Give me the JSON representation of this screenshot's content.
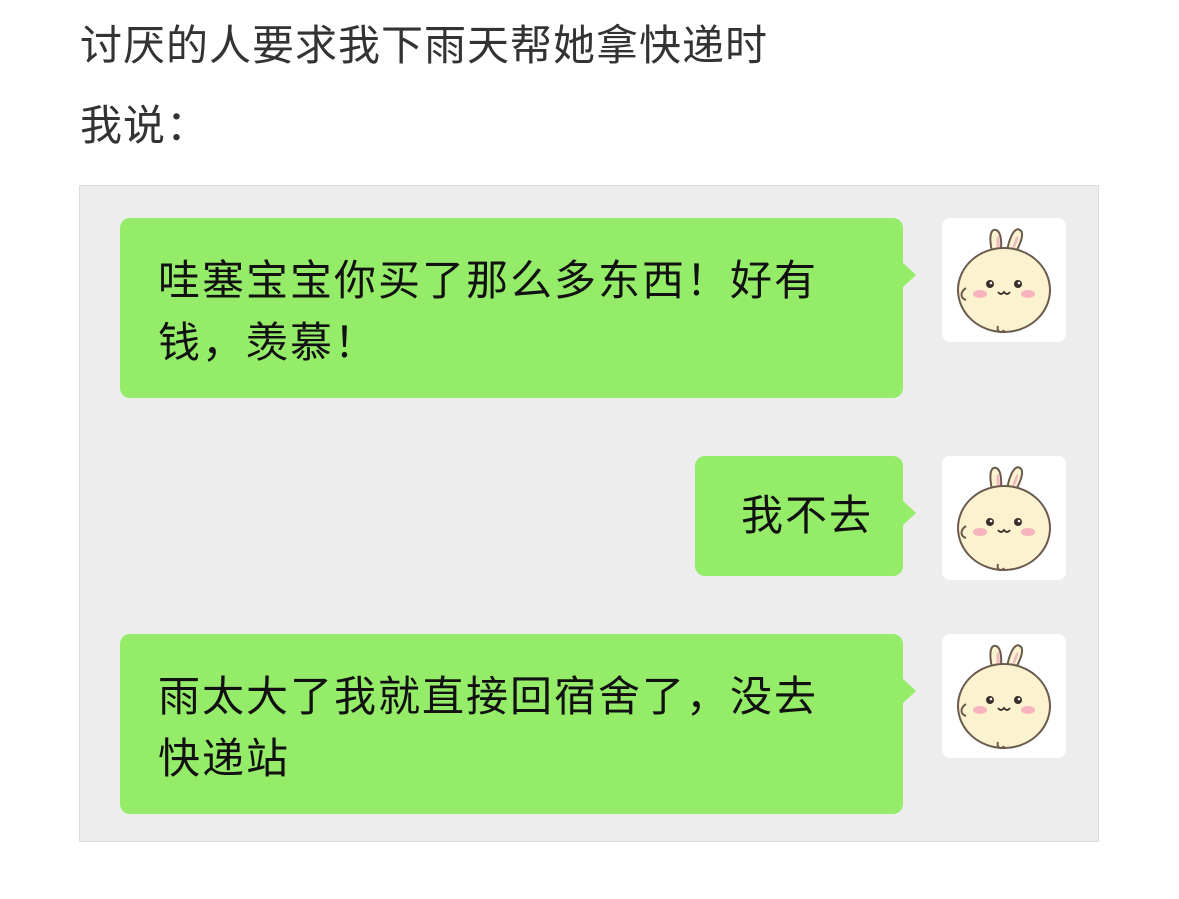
{
  "caption": {
    "line1": "讨厌的人要求我下雨天帮她拿快递时",
    "line2": "我说："
  },
  "messages": [
    {
      "line1": "哇塞宝宝你买了那么多东西！好有",
      "line2": "钱，羡慕！"
    },
    {
      "text": "我不去"
    },
    {
      "line1": "雨太大了我就直接回宿舍了，没去",
      "line2": "快递站"
    }
  ],
  "avatar_icon": "bunny-avatar-icon",
  "colors": {
    "bubble": "#95ec69",
    "chat_background": "#ededed",
    "caption_text": "#333333"
  }
}
